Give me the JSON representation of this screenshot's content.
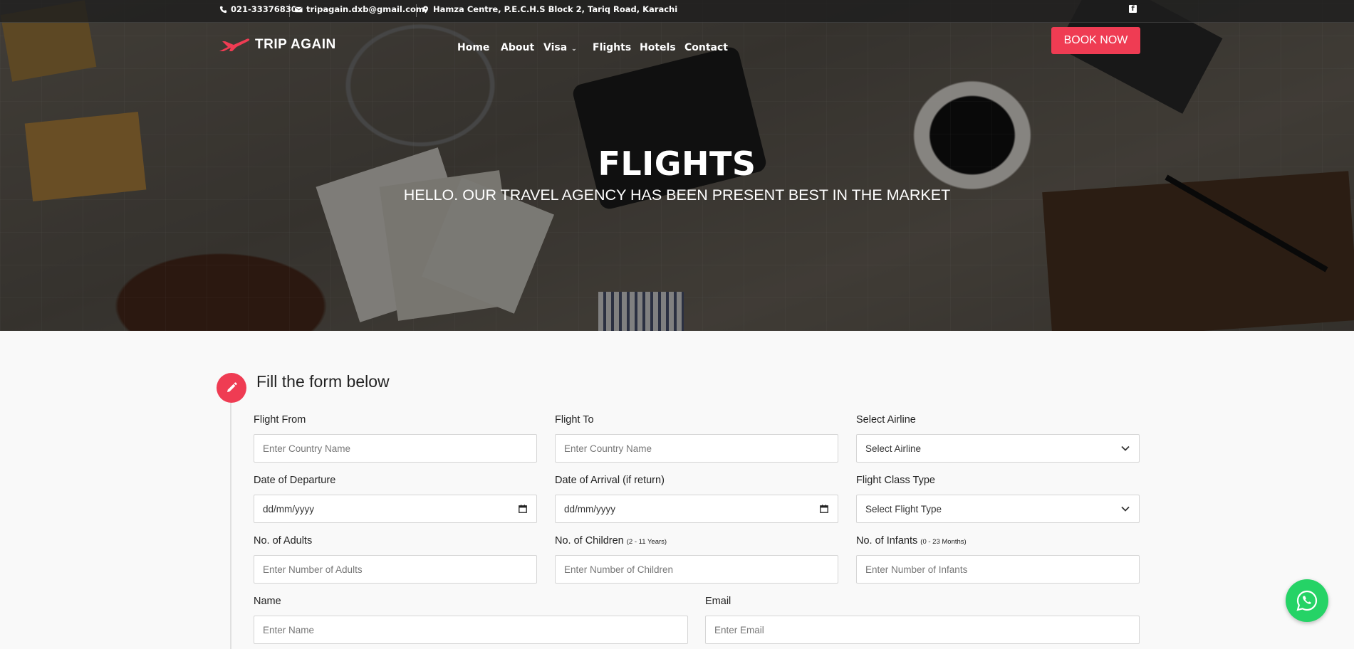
{
  "topbar": {
    "phone": "021-33376830",
    "email": "tripagain.dxb@gmail.com",
    "address": "Hamza Centre, P.E.C.H.S Block 2, Tariq Road, Karachi",
    "social_icon": "facebook-icon"
  },
  "logo": {
    "text": "TRIP AGAIN",
    "icon": "plane-icon",
    "brand_color": "#ef3c53"
  },
  "nav": {
    "items": [
      {
        "label": "Home"
      },
      {
        "label": "About"
      },
      {
        "label": "Visa",
        "dropdown": true
      },
      {
        "label": "Flights"
      },
      {
        "label": "Hotels"
      },
      {
        "label": "Contact"
      }
    ],
    "book_now": "BOOK NOW"
  },
  "hero": {
    "title": "FLIGHTS",
    "subtitle": "HELLO. OUR TRAVEL AGENCY HAS BEEN PRESENT BEST IN THE MARKET"
  },
  "form": {
    "title": "Fill the form below",
    "icon": "pencil-icon",
    "flight_from": {
      "label": "Flight From",
      "placeholder": "Enter Country Name"
    },
    "flight_to": {
      "label": "Flight To",
      "placeholder": "Enter Country Name"
    },
    "airline": {
      "label": "Select Airline",
      "value": "Select Airline"
    },
    "departure": {
      "label": "Date of Departure",
      "value": "dd/mm/yyyy"
    },
    "arrival": {
      "label": "Date of Arrival (if return)",
      "value": "dd/mm/yyyy"
    },
    "class_type": {
      "label": "Flight Class Type",
      "value": "Select Flight Type"
    },
    "adults": {
      "label": "No. of Adults",
      "placeholder": "Enter Number of Adults"
    },
    "children": {
      "label": "No. of Children",
      "note": "(2 - 11 Years)",
      "placeholder": "Enter Number of Children"
    },
    "infants": {
      "label": "No. of Infants",
      "note": "(0 - 23 Months)",
      "placeholder": "Enter Number of Infants"
    },
    "name": {
      "label": "Name",
      "placeholder": "Enter Name"
    },
    "email": {
      "label": "Email",
      "placeholder": "Enter Email"
    }
  },
  "whatsapp": {
    "icon": "whatsapp-icon",
    "color": "#25d366"
  }
}
